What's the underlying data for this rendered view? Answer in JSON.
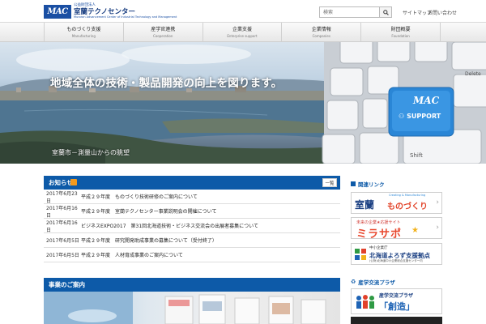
{
  "header": {
    "logo_mark": "MAC",
    "logo_sub": "公益財団法人",
    "logo_main": "室蘭テクノセンター",
    "logo_en": "Muroran Advancement Center of Industrial Technology and Management",
    "search_placeholder": "検索",
    "links": [
      "サイトマップ",
      "お問い合わせ"
    ]
  },
  "nav": {
    "items": [
      {
        "jp": "ものづくり支援",
        "en": "Manufacturing"
      },
      {
        "jp": "産学官連携",
        "en": "Cooperation"
      },
      {
        "jp": "企業支援",
        "en": "Enterprise support"
      },
      {
        "jp": "企業情報",
        "en": "Companies"
      },
      {
        "jp": "財団概要",
        "en": "Foundation"
      }
    ]
  },
  "hero": {
    "caption": "地域全体の技術・製品開発の向上を図ります。",
    "sub_caption": "室蘭市－測量山からの眺望",
    "key_brand": "MAC",
    "key_support": "SUPPORT",
    "key_shift": "Shift",
    "key_delete": "Delete"
  },
  "news": {
    "title": "お知らせ",
    "list_button": "一覧",
    "items": [
      {
        "date": "2017年6月23日",
        "text": "平成２９年度　ものづくり技術研修のご案内について"
      },
      {
        "date": "2017年6月16日",
        "text": "平成２９年度　室蘭テクノセンター事業説明会の開催について"
      },
      {
        "date": "2017年6月16日",
        "text": "ビジネスEXPO2017　第31回北海道技術・ビジネス交流会の出展者募集について"
      },
      {
        "date": "2017年6月5日",
        "text": "平成２９年度　研究開発助成事業の募集について（受付終了）"
      },
      {
        "date": "2017年6月5日",
        "text": "平成２９年度　人材育成事業のご案内について"
      }
    ]
  },
  "feature": {
    "title": "事業のご案内"
  },
  "sidebar": {
    "links_title": "関連リンク",
    "exchange_title": "産学交流プラザ",
    "banners": [
      {
        "title_a": "室蘭",
        "title_b": "ものづくり",
        "tag": "Creating & Manufacturing"
      },
      {
        "top": "未来の企業★応援サイト",
        "title": "ミラサポ"
      },
      {
        "top": "中小企業庁",
        "title": "北海道よろず支援拠点",
        "bottom": "(公財)北海道中小企業総合支援センター内"
      },
      {
        "top": "産学交流プラザ",
        "title": "「創造」"
      }
    ]
  },
  "colors": {
    "brand_blue": "#0d5aa8",
    "logo_blue": "#1a4fa3",
    "rss_orange": "#f39a1e",
    "key_blue": "#2a86d6"
  }
}
